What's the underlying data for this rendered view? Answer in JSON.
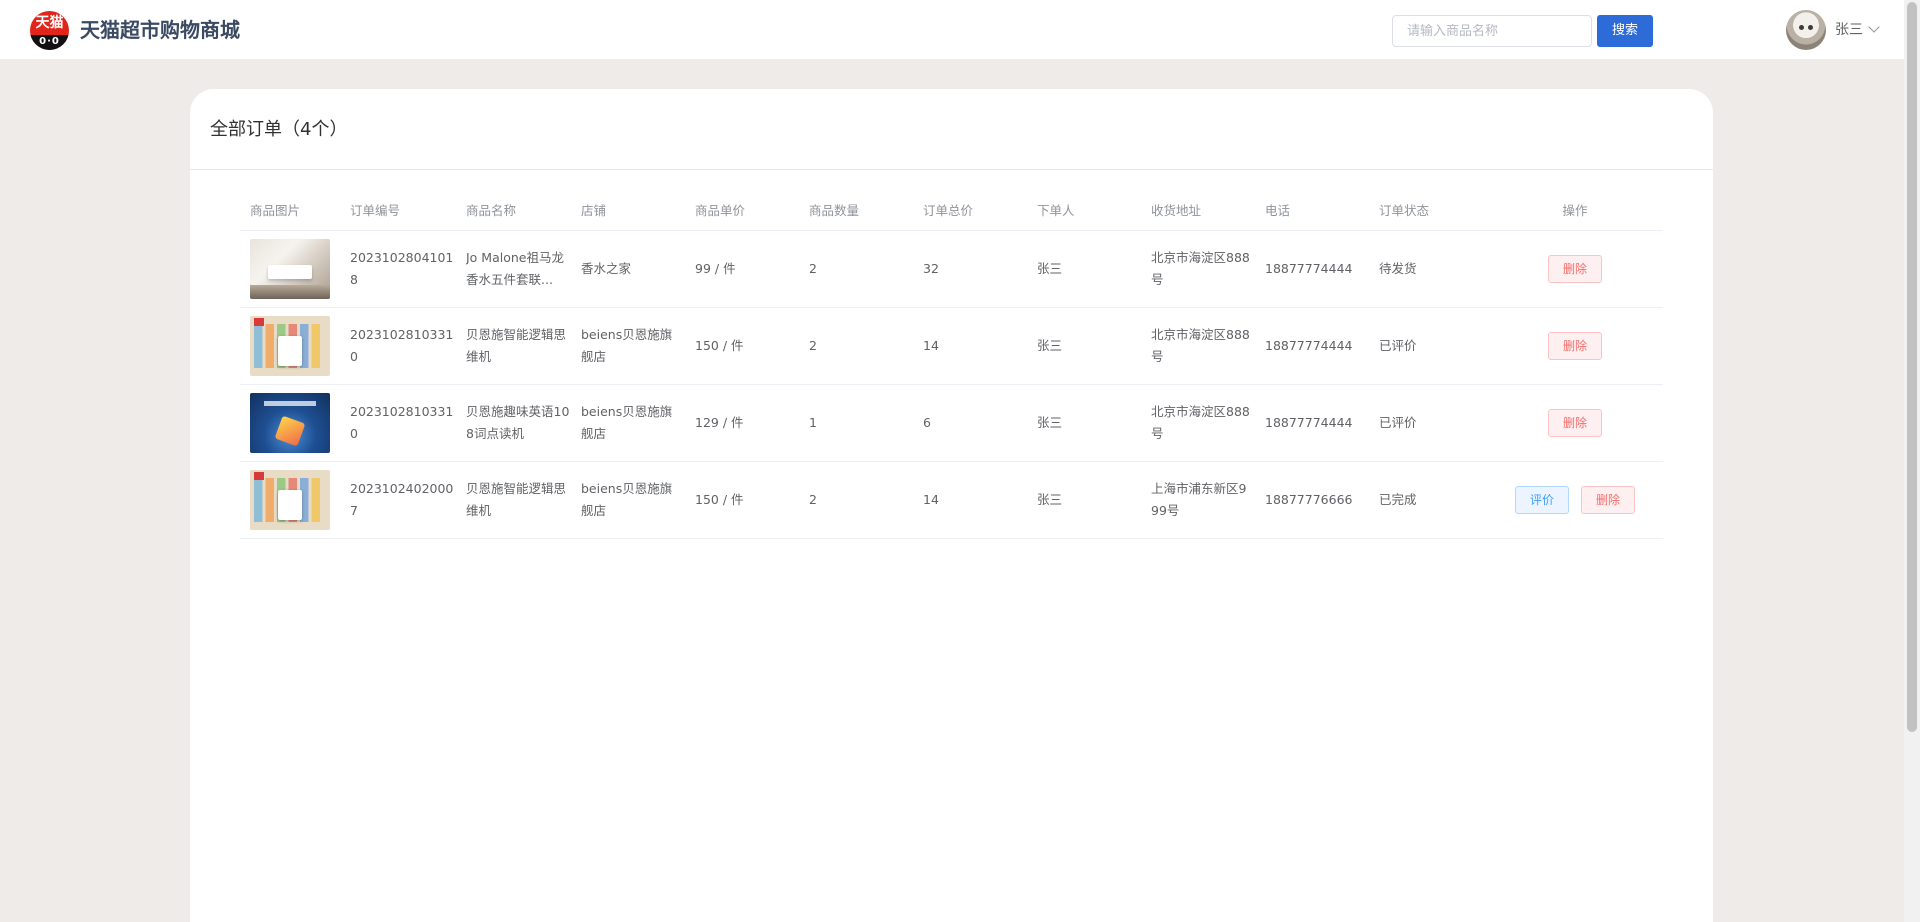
{
  "header": {
    "logo_text": "天猫",
    "logo_face": "0·0",
    "site_title": "天猫超市购物商城",
    "search_placeholder": "请输入商品名称",
    "search_label": "搜索",
    "user_name": "张三"
  },
  "orders": {
    "title": "全部订单（4个）",
    "columns": [
      "商品图片",
      "订单编号",
      "商品名称",
      "店铺",
      "商品单价",
      "商品数量",
      "订单总价",
      "下单人",
      "收货地址",
      "电话",
      "订单状态",
      "操作"
    ],
    "rows": [
      {
        "image": "perfume-product-image",
        "order_id": "20231028041018",
        "product_name": "Jo Malone祖马龙香水五件套联...",
        "shop": "香水之家",
        "unit_price": "99 / 件",
        "quantity": "2",
        "total": "32",
        "buyer": "张三",
        "address": "北京市海淀区888号",
        "phone": "18877774444",
        "status": "待发货",
        "actions": [
          "删除"
        ]
      },
      {
        "image": "logic-learning-machine-image",
        "order_id": "20231028103310",
        "product_name": "贝恩施智能逻辑思维机",
        "shop": "beiens贝恩施旗舰店",
        "unit_price": "150 / 件",
        "quantity": "2",
        "total": "14",
        "buyer": "张三",
        "address": "北京市海淀区888号",
        "phone": "18877774444",
        "status": "已评价",
        "actions": [
          "删除"
        ]
      },
      {
        "image": "english-reading-pen-image",
        "order_id": "20231028103310",
        "product_name": "贝恩施趣味英语108词点读机",
        "shop": "beiens贝恩施旗舰店",
        "unit_price": "129 / 件",
        "quantity": "1",
        "total": "6",
        "buyer": "张三",
        "address": "北京市海淀区888号",
        "phone": "18877774444",
        "status": "已评价",
        "actions": [
          "删除"
        ]
      },
      {
        "image": "logic-learning-machine-image",
        "order_id": "20231024020007",
        "product_name": "贝恩施智能逻辑思维机",
        "shop": "beiens贝恩施旗舰店",
        "unit_price": "150 / 件",
        "quantity": "2",
        "total": "14",
        "buyer": "张三",
        "address": "上海市浦东新区999号",
        "phone": "18877776666",
        "status": "已完成",
        "actions": [
          "评价",
          "删除"
        ]
      }
    ]
  }
}
